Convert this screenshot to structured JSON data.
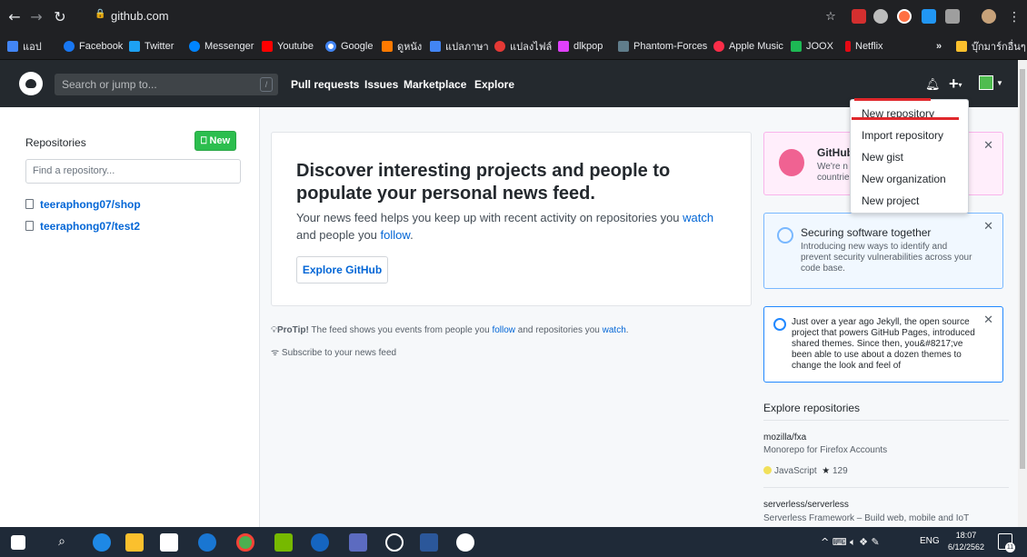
{
  "browser": {
    "url": "github.com",
    "bookmarks": [
      {
        "label": "แอป",
        "color": "#4285f4"
      },
      {
        "label": "Facebook",
        "color": "#1877f2"
      },
      {
        "label": "Twitter",
        "color": "#1da1f2"
      },
      {
        "label": "Messenger",
        "color": "#0084ff"
      },
      {
        "label": "Youtube",
        "color": "#ff0000"
      },
      {
        "label": "Google",
        "color": "#ffffff"
      },
      {
        "label": "ดูหนัง",
        "color": "#ff7a00"
      },
      {
        "label": "แปลภาษา",
        "color": "#4285f4"
      },
      {
        "label": "แปลงไฟล์",
        "color": "#e53935"
      },
      {
        "label": "dlkpop",
        "color": "#e040fb"
      },
      {
        "label": "Phantom-Forces",
        "color": "#607d8b"
      },
      {
        "label": "Apple Music",
        "color": "#fa2d48"
      },
      {
        "label": "JOOX",
        "color": "#1db954"
      },
      {
        "label": "Netflix",
        "color": "#e50914"
      },
      {
        "label": "บุ๊กมาร์กอื่นๆ",
        "color": "#fbc02d"
      }
    ],
    "more_label": "»"
  },
  "header": {
    "search_placeholder": "Search or jump to...",
    "search_key": "/",
    "nav": [
      "Pull requests",
      "Issues",
      "Marketplace",
      "Explore"
    ]
  },
  "sidebar": {
    "title": "Repositories",
    "new_label": "New",
    "find_placeholder": "Find a repository...",
    "repos": [
      "teeraphong07/shop",
      "teeraphong07/test2"
    ]
  },
  "main": {
    "discover_title": "Discover interesting projects and people to populate your personal news feed.",
    "discover_text_1": "Your news feed helps you keep up with recent activity on repositories you ",
    "discover_link_watch": "watch",
    "discover_text_2": "and people you ",
    "discover_link_follow": "follow",
    "discover_text_3": ".",
    "explore_button": "Explore GitHub",
    "protip_bold": "ProTip!",
    "protip_text": " The feed shows you events from people you ",
    "protip_follow": "follow",
    "protip_mid": " and repositories you ",
    "protip_watch": "watch",
    "protip_end": ".",
    "subscribe": "Subscribe to your news feed"
  },
  "cards": {
    "card1_title": "GitHub",
    "card1_text_1": "We're n",
    "card1_text_2": "countrie",
    "card2_title": "Securing software together",
    "card2_text": "Introducing new ways to identify and prevent security vulnerabilities across your code base.",
    "card3_text": "Just over a year ago Jekyll, the open source project that powers GitHub Pages, introduced shared themes. Since then, you&#8217;ve been able to use about a dozen themes to change the look and feel of",
    "close_glyph": "✕"
  },
  "explore": {
    "title": "Explore repositories",
    "repo1_name": "mozilla/fxa",
    "repo1_desc": "Monorepo for Firefox Accounts",
    "repo1_lang": "JavaScript",
    "repo1_stars": "129",
    "repo2_name": "serverless/serverless",
    "repo2_desc": "Serverless Framework – Build web, mobile and IoT"
  },
  "dropdown": {
    "items": [
      "New repository",
      "Import repository",
      "New gist",
      "New organization",
      "New project"
    ]
  },
  "taskbar": {
    "lang": "ENG",
    "time": "18:07",
    "date": "6/12/2562",
    "notif_count": "11"
  },
  "colors": {
    "github_header": "#24292e",
    "new_button": "#2cbe4e",
    "link": "#0366d6",
    "annotation_red": "#e0282c"
  }
}
